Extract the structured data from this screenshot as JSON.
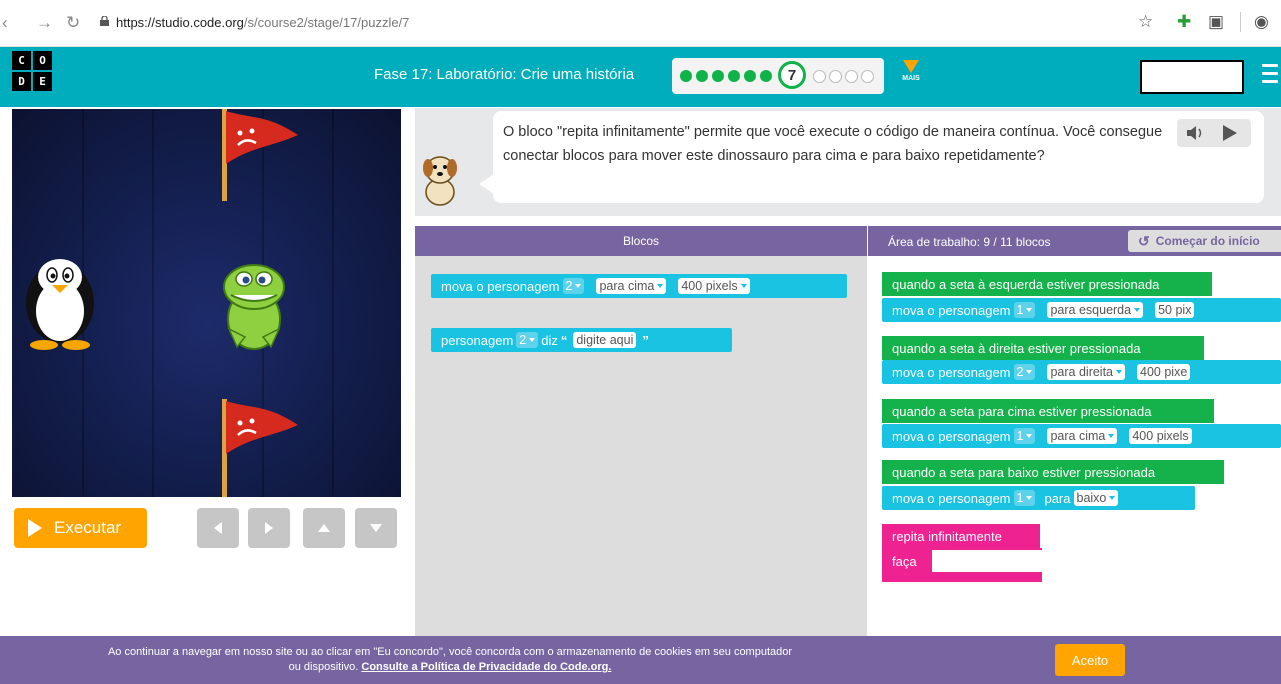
{
  "browser": {
    "url_host": "https://studio.code.org",
    "url_path": "/s/course2/stage/17/puzzle/7"
  },
  "header": {
    "logo_letters": [
      "C",
      "O",
      "D",
      "E"
    ],
    "stage_title": "Fase 17: Laboratório: Crie uma história",
    "progress": {
      "completed": 6,
      "current": "7",
      "remaining": 4
    },
    "more_label": "MAIS"
  },
  "instructions": {
    "text": "O bloco \"repita infinitamente\" permite que você execute o código de maneira contínua. Você consegue conectar blocos para mover este dinossauro para cima e para baixo repetidamente?"
  },
  "controls": {
    "run_label": "Executar"
  },
  "toolbox": {
    "header": "Blocos",
    "blocks": [
      {
        "parts": [
          "mova o personagem",
          "2",
          "para cima",
          "400 pixels"
        ]
      },
      {
        "parts": [
          "personagem",
          "2",
          "diz",
          "digite aqui"
        ]
      }
    ]
  },
  "workspace": {
    "count_label": "Área de trabalho: 9 / 11 blocos",
    "reset_label": "Começar do início",
    "events": [
      {
        "event": "quando a seta à esquerda estiver pressionada",
        "move": [
          "mova o personagem",
          "1",
          "para esquerda",
          "50 pix"
        ]
      },
      {
        "event": "quando a seta à direita estiver pressionada",
        "move": [
          "mova o personagem",
          "2",
          "para direita",
          "400 pixe"
        ]
      },
      {
        "event": "quando a seta para cima estiver pressionada",
        "move": [
          "mova o personagem",
          "1",
          "para cima",
          "400 pixels"
        ]
      },
      {
        "event": "quando a seta para baixo estiver pressionada",
        "move": [
          "mova o personagem",
          "1",
          "para",
          "baixo"
        ]
      }
    ],
    "repeat": {
      "label": "repita infinitamente",
      "do_label": "faça"
    }
  },
  "cookie": {
    "line1": "Ao continuar a navegar em nosso site ou ao clicar em \"Eu concordo\", você concorda com o armazenamento de cookies em seu computador",
    "line2_prefix": "ou dispositivo.",
    "link": "Consulte a Política de Privacidade do Code.org.",
    "accept": "Aceito"
  },
  "colors": {
    "header": "#00adbc",
    "block_cyan": "#19c3e1",
    "block_green": "#15b14b",
    "block_pink": "#ee2290",
    "toolbar_purple": "#7665a0",
    "run_orange": "#ffa400"
  }
}
